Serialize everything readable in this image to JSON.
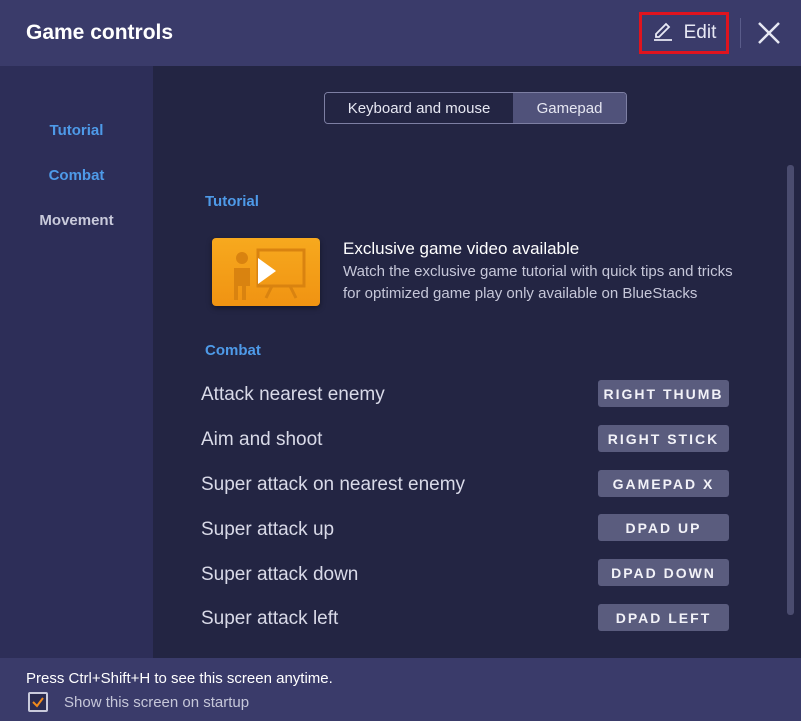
{
  "header": {
    "title": "Game controls",
    "edit_label": "Edit"
  },
  "sidebar": {
    "items": [
      {
        "label": "Tutorial"
      },
      {
        "label": "Combat"
      },
      {
        "label": "Movement"
      }
    ]
  },
  "tabs": {
    "keyboard": "Keyboard and mouse",
    "gamepad": "Gamepad",
    "selected": "Gamepad"
  },
  "tutorial": {
    "heading": "Tutorial",
    "video_title": "Exclusive game video available",
    "video_desc": "Watch the exclusive game tutorial with quick tips and tricks for optimized game play only available on BlueStacks"
  },
  "combat": {
    "heading": "Combat",
    "controls": [
      {
        "action": "Attack nearest enemy",
        "key": "RIGHT THUMB"
      },
      {
        "action": "Aim and shoot",
        "key": "RIGHT STICK"
      },
      {
        "action": "Super attack on nearest enemy",
        "key": "GAMEPAD X"
      },
      {
        "action": "Super attack up",
        "key": "DPAD UP"
      },
      {
        "action": "Super attack down",
        "key": "DPAD DOWN"
      },
      {
        "action": "Super attack left",
        "key": "DPAD LEFT"
      }
    ]
  },
  "footer": {
    "hint": "Press Ctrl+Shift+H to see this screen anytime.",
    "startup_label": "Show this screen on startup",
    "startup_checked": true
  },
  "colors": {
    "accent": "#4e9ae8",
    "header_bg": "#3a3b6a",
    "highlight": "#e0141e",
    "checkmark": "#f08a1c"
  }
}
